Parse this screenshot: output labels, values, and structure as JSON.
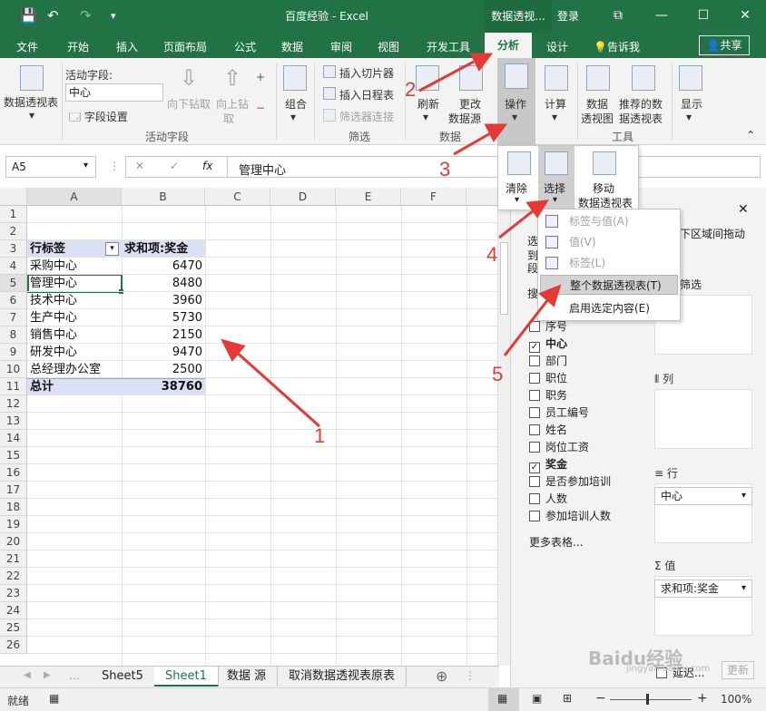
{
  "titlebar": {
    "title": "百度经验 - Excel",
    "context_tab": "数据透视...",
    "login": "登录",
    "qa_save": "💾",
    "qa_undo": "↶",
    "qa_redo": "↷",
    "qa_customize": "▾",
    "restore": "⧉",
    "minimize": "—",
    "maximize": "☐",
    "close": "✕"
  },
  "tabs": [
    "文件",
    "开始",
    "插入",
    "页面布局",
    "公式",
    "数据",
    "审阅",
    "视图",
    "开发工具",
    "分析",
    "设计"
  ],
  "tell_me": "告诉我",
  "share": "共享",
  "ribbon": {
    "pivot_table": "数据透视表",
    "active_field_label": "活动字段:",
    "active_field_value": "中心",
    "field_settings": "字段设置",
    "drill_down": "向下钻取",
    "drill_up_1": "向上钻",
    "drill_up_2": "取",
    "group_active_field": "活动字段",
    "group": "组合",
    "insert_slicer": "插入切片器",
    "insert_timeline": "插入日程表",
    "filter_connections": "筛选器连接",
    "group_filter": "筛选",
    "refresh": "刷新",
    "change_source_1": "更改",
    "change_source_2": "数据源",
    "group_data": "数据",
    "actions": "操作",
    "calculations": "计算",
    "pivot_chart_1": "数据",
    "pivot_chart_2": "透视图",
    "recommended_1": "推荐的数",
    "recommended_2": "据透视表",
    "group_tools": "工具",
    "show": "显示"
  },
  "actions_panel": {
    "clear": "清除",
    "select": "选择",
    "move_1": "移动",
    "move_2": "数据透视表"
  },
  "select_menu": [
    "标签与值(A)",
    "值(V)",
    "标签(L)",
    "整个数据透视表(T)",
    "启用选定内容(E)"
  ],
  "formula": {
    "namebox": "A5",
    "content": "管理中心",
    "fx": "fx",
    "cancel": "✕",
    "enter": "✓"
  },
  "columns": [
    "A",
    "B",
    "C",
    "D",
    "E",
    "F"
  ],
  "rows": [
    "1",
    "2",
    "3",
    "4",
    "5",
    "6",
    "7",
    "8",
    "9",
    "10",
    "11",
    "12",
    "13",
    "14",
    "15",
    "16",
    "17",
    "18",
    "19",
    "20",
    "21",
    "22",
    "23",
    "24",
    "25",
    "26"
  ],
  "pivot": {
    "header_label": "行标签",
    "header_value": "求和项:奖金",
    "items": [
      {
        "label": "采购中心",
        "value": "6470"
      },
      {
        "label": "管理中心",
        "value": "8480"
      },
      {
        "label": "技术中心",
        "value": "3960"
      },
      {
        "label": "生产中心",
        "value": "5730"
      },
      {
        "label": "销售中心",
        "value": "2150"
      },
      {
        "label": "研发中心",
        "value": "9470"
      },
      {
        "label": "总经理办公室",
        "value": "2500"
      }
    ],
    "total_label": "总计",
    "total_value": "38760"
  },
  "sheets": [
    "Sheet5",
    "Sheet1",
    "数据 源",
    "取消数据透视表原表"
  ],
  "status": {
    "ready": "就绪",
    "zoom": "100%"
  },
  "pane": {
    "frag_1": "选",
    "frag_2": "到",
    "frag_3": "段",
    "frag_4": "搜",
    "frag_areas": "下区域间拖动",
    "frag_filter": "筛选",
    "fields": [
      {
        "name": "序号",
        "checked": false
      },
      {
        "name": "中心",
        "checked": true
      },
      {
        "name": "部门",
        "checked": false
      },
      {
        "name": "职位",
        "checked": false
      },
      {
        "name": "职务",
        "checked": false
      },
      {
        "name": "员工编号",
        "checked": false
      },
      {
        "name": "姓名",
        "checked": false
      },
      {
        "name": "岗位工资",
        "checked": false
      },
      {
        "name": "奖金",
        "checked": true
      },
      {
        "name": "是否参加培训",
        "checked": false
      },
      {
        "name": "人数",
        "checked": false
      },
      {
        "name": "参加培训人数",
        "checked": false
      }
    ],
    "more_tables": "更多表格...",
    "columns_title": "列",
    "rows_title": "行",
    "values_title": "值",
    "rows_value": "中心",
    "values_value": "求和项:奖金",
    "defer": "延迟...",
    "update": "更新"
  },
  "annotations": [
    "1",
    "2",
    "3",
    "4",
    "5"
  ],
  "watermark": {
    "text": "Baidu经验",
    "url": "jingyan.baidu.com"
  },
  "colors": {
    "excel_green": "#217346",
    "arrow_red": "#e53935",
    "pivot_header": "#d9e1f2"
  }
}
